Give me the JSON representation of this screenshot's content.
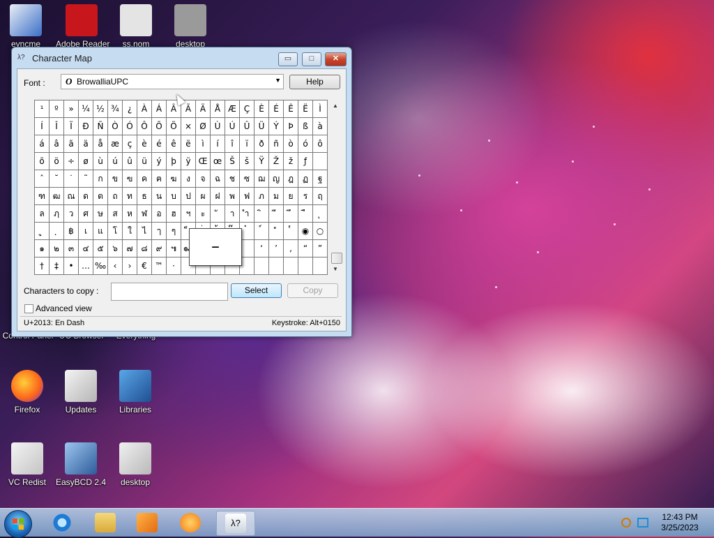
{
  "desktop": {
    "top_icons": [
      {
        "label": "eyncme",
        "icon": "sync-app-icon"
      },
      {
        "label": "Adobe Reader",
        "icon": "adobe-reader-icon"
      },
      {
        "label": "ss.nom",
        "icon": "file-icon"
      },
      {
        "label": "desktop",
        "icon": "settings-file-icon"
      }
    ],
    "middle_row_labels": [
      "Control Panel",
      "UC Browser",
      "Everything"
    ],
    "icons": [
      {
        "label": "Firefox",
        "icon": "firefox-icon"
      },
      {
        "label": "Updates",
        "icon": "updates-folder-icon"
      },
      {
        "label": "Libraries",
        "icon": "libraries-icon"
      },
      {
        "label": "VC Redist",
        "icon": "vc-redist-folder-icon"
      },
      {
        "label": "EasyBCD 2.4",
        "icon": "easybcd-icon"
      },
      {
        "label": "desktop",
        "icon": "settings-file-icon"
      }
    ]
  },
  "window": {
    "title": "Character Map",
    "app_icon": "charmap-icon",
    "controls": {
      "minimize": "▭",
      "maximize": "□",
      "close": "✕"
    },
    "font_label": "Font :",
    "font_value": "BrowalliaUPC",
    "font_type_icon": "O",
    "help_label": "Help",
    "grid_rows": [
      [
        "¹",
        "º",
        "»",
        "¼",
        "½",
        "¾",
        "¿",
        "À",
        "Á",
        "Â",
        "Ã",
        "Ä",
        "Å",
        "Æ",
        "Ç",
        "È",
        "É",
        "Ê",
        "Ë",
        "Ì"
      ],
      [
        "Í",
        "Î",
        "Ï",
        "Ð",
        "Ñ",
        "Ò",
        "Ó",
        "Ô",
        "Õ",
        "Ö",
        "×",
        "Ø",
        "Ù",
        "Ú",
        "Û",
        "Ü",
        "Ý",
        "Þ",
        "ß",
        "à"
      ],
      [
        "á",
        "â",
        "ã",
        "ä",
        "å",
        "æ",
        "ç",
        "è",
        "é",
        "ê",
        "ë",
        "ì",
        "í",
        "î",
        "ï",
        "ð",
        "ñ",
        "ò",
        "ó",
        "ô"
      ],
      [
        "õ",
        "ö",
        "÷",
        "ø",
        "ù",
        "ú",
        "û",
        "ü",
        "ý",
        "þ",
        "ÿ",
        "Œ",
        "œ",
        "Š",
        "š",
        "Ÿ",
        "Ž",
        "ž",
        "ƒ",
        ""
      ],
      [
        "ˆ",
        "˘",
        "˙",
        "˜",
        "ก",
        "ข",
        "ฃ",
        "ค",
        "ฅ",
        "ฆ",
        "ง",
        "จ",
        "ฉ",
        "ช",
        "ซ",
        "ฌ",
        "ญ",
        "ฎ",
        "ฏ",
        "ฐ"
      ],
      [
        "ฑ",
        "ฒ",
        "ณ",
        "ด",
        "ต",
        "ถ",
        "ท",
        "ธ",
        "น",
        "บ",
        "ป",
        "ผ",
        "ฝ",
        "พ",
        "ฟ",
        "ภ",
        "ม",
        "ย",
        "ร",
        "ฤ"
      ],
      [
        "ล",
        "ฦ",
        "ว",
        "ศ",
        "ษ",
        "ส",
        "ห",
        "ฬ",
        "อ",
        "ฮ",
        "ฯ",
        "ะ",
        "ั",
        "า",
        "ำ",
        "ิ",
        "ี",
        "ึ",
        "ื",
        "ุ"
      ],
      [
        "ู",
        "ฺ",
        "฿",
        "เ",
        "แ",
        "โ",
        "ใ",
        "ไ",
        "ๅ",
        "ๆ",
        "็",
        "่",
        "้",
        "๊",
        "๋",
        "์",
        "ํ",
        "๎",
        "◉",
        "○"
      ],
      [
        "๑",
        "๒",
        "๓",
        "๔",
        "๕",
        "๖",
        "๗",
        "๘",
        "๙",
        "๚",
        "๛",
        "",
        "",
        "",
        "",
        "‘",
        "’",
        ",",
        "“",
        "”"
      ],
      [
        "†",
        "‡",
        "•",
        "…",
        "‰",
        "‹",
        "›",
        "€",
        "™",
        "·",
        "",
        "",
        "",
        "",
        "",
        "",
        "",
        "",
        "",
        ""
      ]
    ],
    "zoom_char": "–",
    "copy_label": "Characters to copy :",
    "copy_value": "",
    "select_label": "Select",
    "copy_button_label": "Copy",
    "advanced_label": "Advanced view",
    "status_left": "U+2013: En Dash",
    "status_right": "Keystroke: Alt+0150"
  },
  "taskbar": {
    "pinned": [
      {
        "icon": "internet-explorer-icon"
      },
      {
        "icon": "file-explorer-icon"
      },
      {
        "icon": "media-player-icon"
      },
      {
        "icon": "uc-browser-icon"
      },
      {
        "icon": "charmap-taskbar-icon",
        "active": true
      }
    ],
    "tray_icons": [
      "search-tray-icon",
      "display-tray-icon"
    ],
    "time": "12:43 PM",
    "date": "3/25/2023"
  },
  "colors": {
    "accent_blue": "#3c7fb1",
    "window_frame": "#c6dcf0",
    "close_red": "#c6452c"
  }
}
